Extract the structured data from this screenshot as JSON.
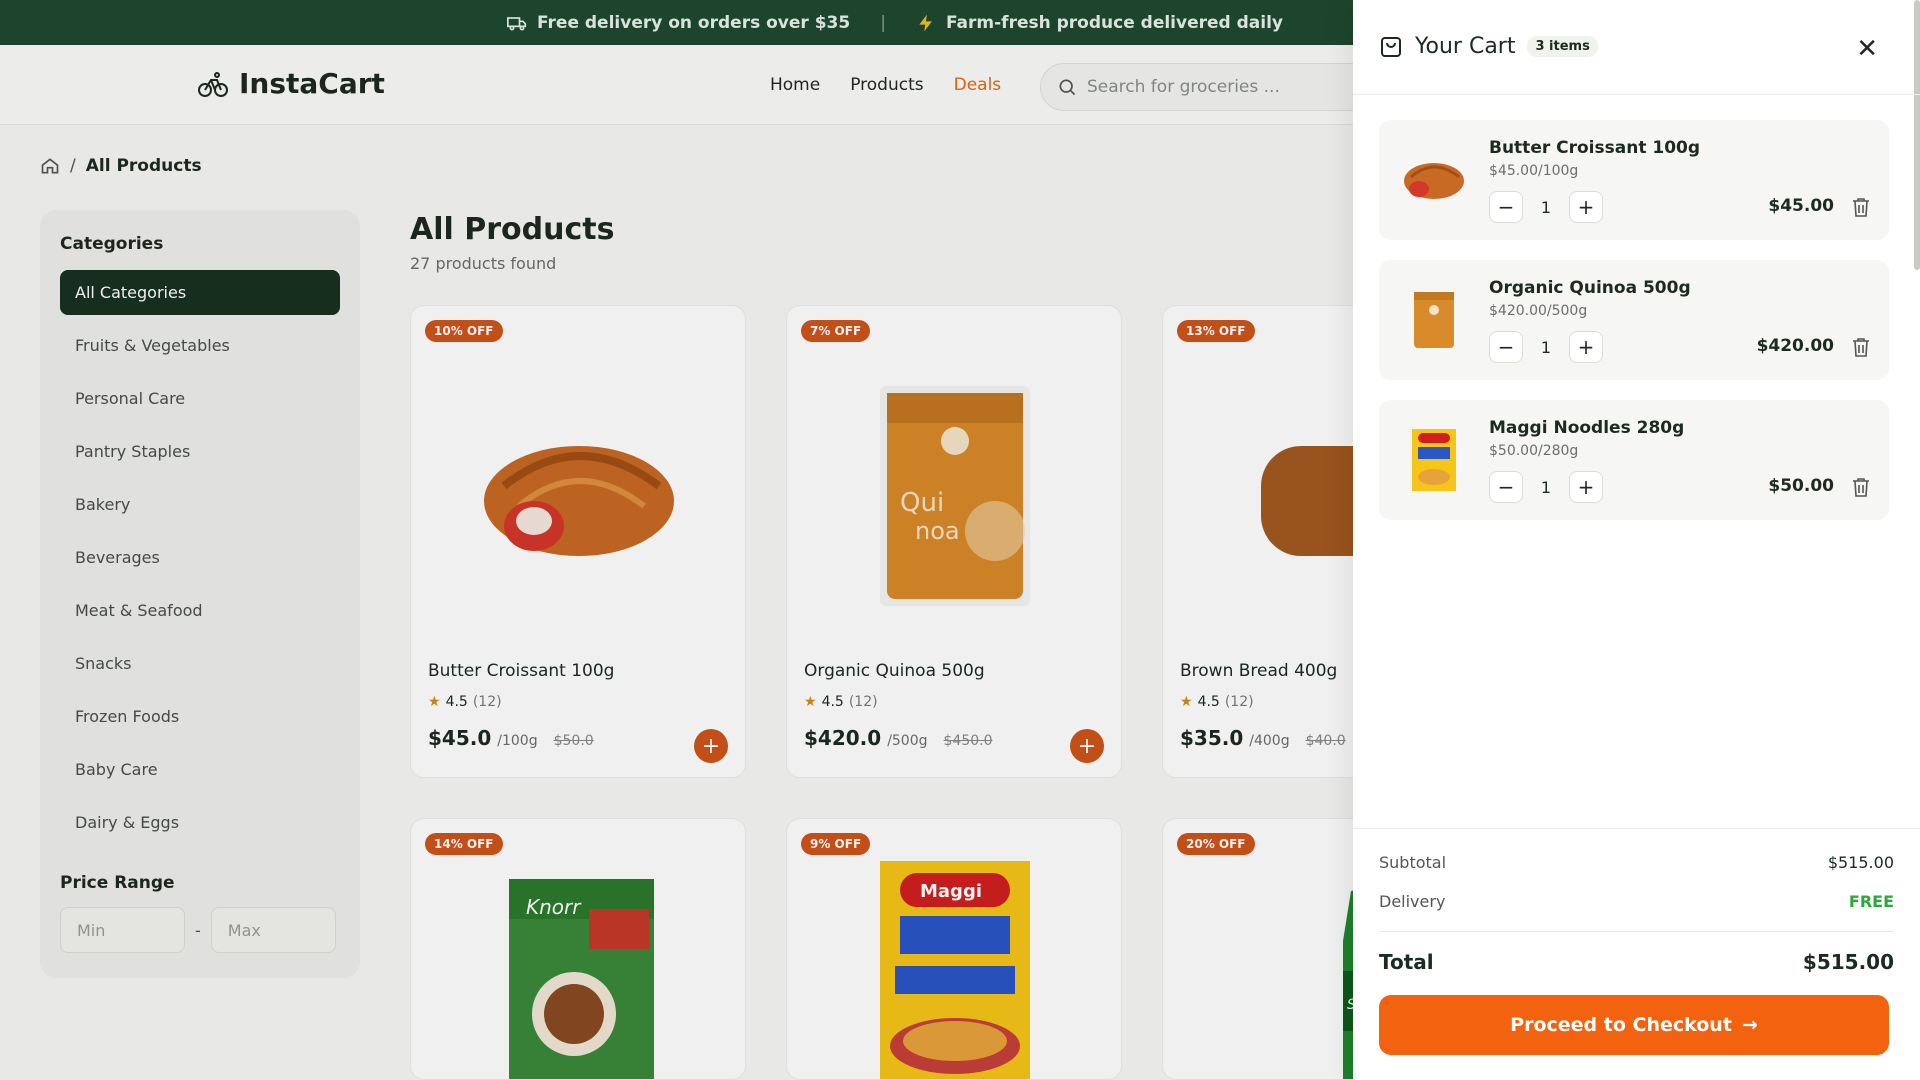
{
  "topbar": {
    "delivery_text": "Free delivery on orders over $35",
    "separator": "|",
    "fresh_text": "Farm-fresh produce delivered daily"
  },
  "header": {
    "brand": "InstaCart",
    "nav": {
      "home": "Home",
      "products": "Products",
      "deals": "Deals"
    },
    "search_placeholder": "Search for groceries ..."
  },
  "breadcrumb": {
    "separator": "/",
    "current": "All Products"
  },
  "sidebar": {
    "categories_title": "Categories",
    "categories": [
      "All Categories",
      "Fruits & Vegetables",
      "Personal Care",
      "Pantry Staples",
      "Bakery",
      "Beverages",
      "Meat & Seafood",
      "Snacks",
      "Frozen Foods",
      "Baby Care",
      "Dairy & Eggs"
    ],
    "price_range_title": "Price Range",
    "min_placeholder": "Min",
    "max_placeholder": "Max",
    "dash": "-"
  },
  "main": {
    "title": "All Products",
    "subtitle": "27 products found"
  },
  "products": [
    {
      "badge": "10% OFF",
      "name": "Butter Croissant 100g",
      "rating": "4.5",
      "reviews": "(12)",
      "price": "$45.0",
      "unit": "/100g",
      "old": "$50.0"
    },
    {
      "badge": "7% OFF",
      "name": "Organic Quinoa 500g",
      "rating": "4.5",
      "reviews": "(12)",
      "price": "$420.0",
      "unit": "/500g",
      "old": "$450.0"
    },
    {
      "badge": "13% OFF",
      "name": "Brown Bread 400g",
      "rating": "4.5",
      "reviews": "(12)",
      "price": "$35.0",
      "unit": "/400g",
      "old": "$40.0"
    },
    {
      "badge": "14% OFF"
    },
    {
      "badge": "9% OFF"
    },
    {
      "badge": "20% OFF"
    }
  ],
  "cart": {
    "title": "Your Cart",
    "count": "3 items",
    "items": [
      {
        "name": "Butter Croissant 100g",
        "unit": "$45.00/100g",
        "qty": "1",
        "total": "$45.00"
      },
      {
        "name": "Organic Quinoa 500g",
        "unit": "$420.00/500g",
        "qty": "1",
        "total": "$420.00"
      },
      {
        "name": "Maggi Noodles 280g",
        "unit": "$50.00/280g",
        "qty": "1",
        "total": "$50.00"
      }
    ],
    "subtotal_label": "Subtotal",
    "subtotal": "$515.00",
    "delivery_label": "Delivery",
    "delivery": "FREE",
    "total_label": "Total",
    "total": "$515.00",
    "checkout": "Proceed to Checkout"
  },
  "colors": {
    "brand_dark": "#1f4a30",
    "accent": "#f3620f",
    "badge": "#d0541a",
    "free": "#2aa83a"
  }
}
